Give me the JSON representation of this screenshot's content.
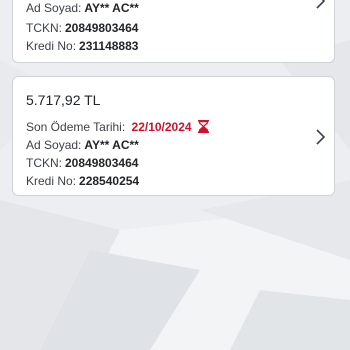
{
  "cards": [
    {
      "name_label": "Ad Soyad:",
      "name_value": "AY** AC**",
      "tckn_label": "TCKN:",
      "tckn_value": "20849803464",
      "loan_label": "Kredi No:",
      "loan_value": "231148883"
    },
    {
      "amount": "5.717,92 TL",
      "due_label": "Son Ödeme Tarihi:",
      "due_value": "22/10/2024",
      "name_label": "Ad Soyad:",
      "name_value": "AY** AC**",
      "tckn_label": "TCKN:",
      "tckn_value": "20849803464",
      "loan_label": "Kredi No:",
      "loan_value": "228540254"
    }
  ],
  "icons": {
    "chevron": "chevron-right-icon",
    "hourglass": "hourglass-icon"
  },
  "colors": {
    "due_date": "#d0112b",
    "card_border": "#cfd3d8",
    "background": "#eceef1"
  }
}
